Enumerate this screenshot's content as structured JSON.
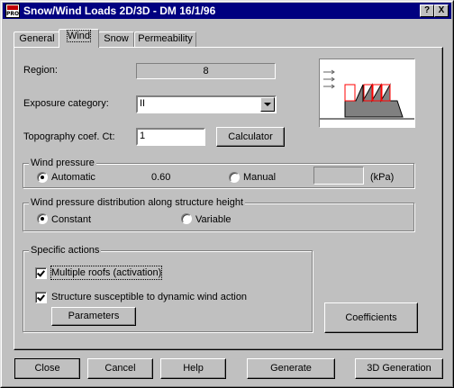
{
  "window": {
    "title": "Snow/Wind Loads 2D/3D - DM 16/1/96",
    "help_button": "?",
    "close_button": "X",
    "app_icon_text": "PRO"
  },
  "tabs": [
    {
      "label": "General"
    },
    {
      "label": "Wind",
      "active": true
    },
    {
      "label": "Snow"
    },
    {
      "label": "Permeability"
    }
  ],
  "wind": {
    "region_label": "Region:",
    "region_value": "8",
    "exposure_label": "Exposure category:",
    "exposure_value": "II",
    "topography_label": "Topography coef. Ct:",
    "topography_value": "1",
    "calculator_button": "Calculator"
  },
  "wind_pressure": {
    "title": "Wind pressure",
    "automatic_label": "Automatic",
    "automatic_selected": true,
    "automatic_value": "0.60",
    "manual_label": "Manual",
    "manual_value": "",
    "unit": "(kPa)"
  },
  "distribution": {
    "title": "Wind pressure distribution along structure height",
    "constant_label": "Constant",
    "constant_selected": true,
    "variable_label": "Variable"
  },
  "specific_actions": {
    "title": "Specific actions",
    "multiple_roofs_label": "Multiple roofs (activation)",
    "multiple_roofs_checked": true,
    "dynamic_label": "Structure susceptible to dynamic wind action",
    "dynamic_checked": true,
    "parameters_button": "Parameters"
  },
  "coefficients_button": "Coefficients",
  "footer": {
    "close": "Close",
    "cancel": "Cancel",
    "help": "Help",
    "generate": "Generate",
    "generation_3d": "3D Generation"
  },
  "colors": {
    "titlebar": "#000080",
    "face": "#c0c0c0",
    "diagram_highlight": "#ff0000",
    "diagram_roof": "#808080"
  }
}
